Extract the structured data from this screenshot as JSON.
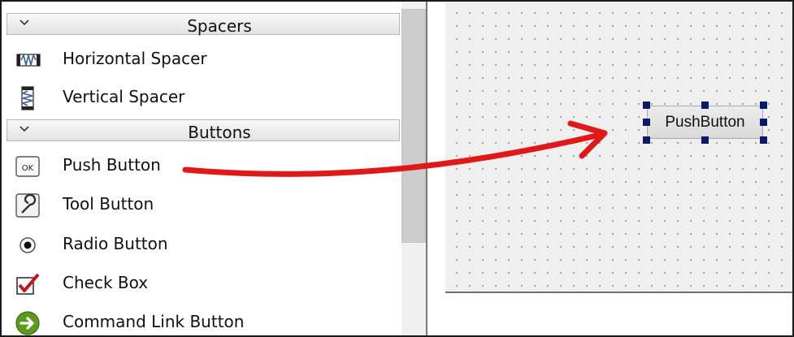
{
  "widget_box": {
    "categories": [
      {
        "label": "Spacers",
        "items": [
          {
            "label": "Horizontal Spacer",
            "icon": "horizontal-spacer-icon"
          },
          {
            "label": "Vertical Spacer",
            "icon": "vertical-spacer-icon"
          }
        ]
      },
      {
        "label": "Buttons",
        "items": [
          {
            "label": "Push Button",
            "icon": "push-button-icon",
            "icon_text": "OK"
          },
          {
            "label": "Tool Button",
            "icon": "tool-button-icon"
          },
          {
            "label": "Radio Button",
            "icon": "radio-button-icon"
          },
          {
            "label": "Check Box",
            "icon": "check-box-icon"
          },
          {
            "label": "Command Link Button",
            "icon": "command-link-icon"
          }
        ]
      }
    ]
  },
  "form": {
    "placed_widget": {
      "label": "PushButton",
      "type": "push-button",
      "selected": true
    }
  },
  "annotation": {
    "arrow_color": "#e01818",
    "meaning": "drag from widget box to form"
  },
  "colors": {
    "handle": "#0a1a6a",
    "form_background": "#efefef",
    "grid_dot": "#9a9a9a"
  }
}
